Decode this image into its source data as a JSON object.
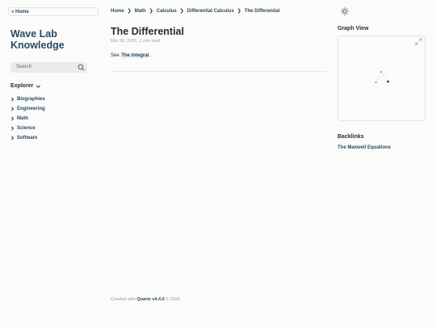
{
  "nav": {
    "home_label": "« Home"
  },
  "site": {
    "title": "Wave Lab Knowledge"
  },
  "search": {
    "placeholder": "Search"
  },
  "explorer": {
    "heading": "Explorer",
    "folders": [
      {
        "label": "Biographies"
      },
      {
        "label": "Engineering"
      },
      {
        "label": "Math"
      },
      {
        "label": "Science"
      },
      {
        "label": "Software"
      }
    ]
  },
  "breadcrumb": {
    "items": [
      "Home",
      "Math",
      "Calculus",
      "Differential Calculus",
      "The Differential"
    ],
    "separator": "❯"
  },
  "page": {
    "title": "The Differential",
    "date": "Mar 28, 2026",
    "read_time": "1 min read",
    "body_prefix": "See ",
    "link_text": "The integral",
    "body_suffix": "."
  },
  "footer": {
    "prefix": "Created with ",
    "brand": "Quartz v4.4.0",
    "suffix": " © 2026"
  },
  "graph": {
    "title": "Graph View"
  },
  "backlinks": {
    "title": "Backlinks",
    "items": [
      "The Maxwell Equations"
    ]
  },
  "colors": {
    "accent": "#284b63",
    "background": "#fbfbfa",
    "text": "#2b2b2b",
    "muted": "#a0a0a0"
  },
  "icons": {
    "search": "search-icon",
    "theme": "sun-icon",
    "expand": "expand-graph-icon",
    "folder": "chevron-right-icon",
    "explorer": "chevron-down-icon"
  }
}
